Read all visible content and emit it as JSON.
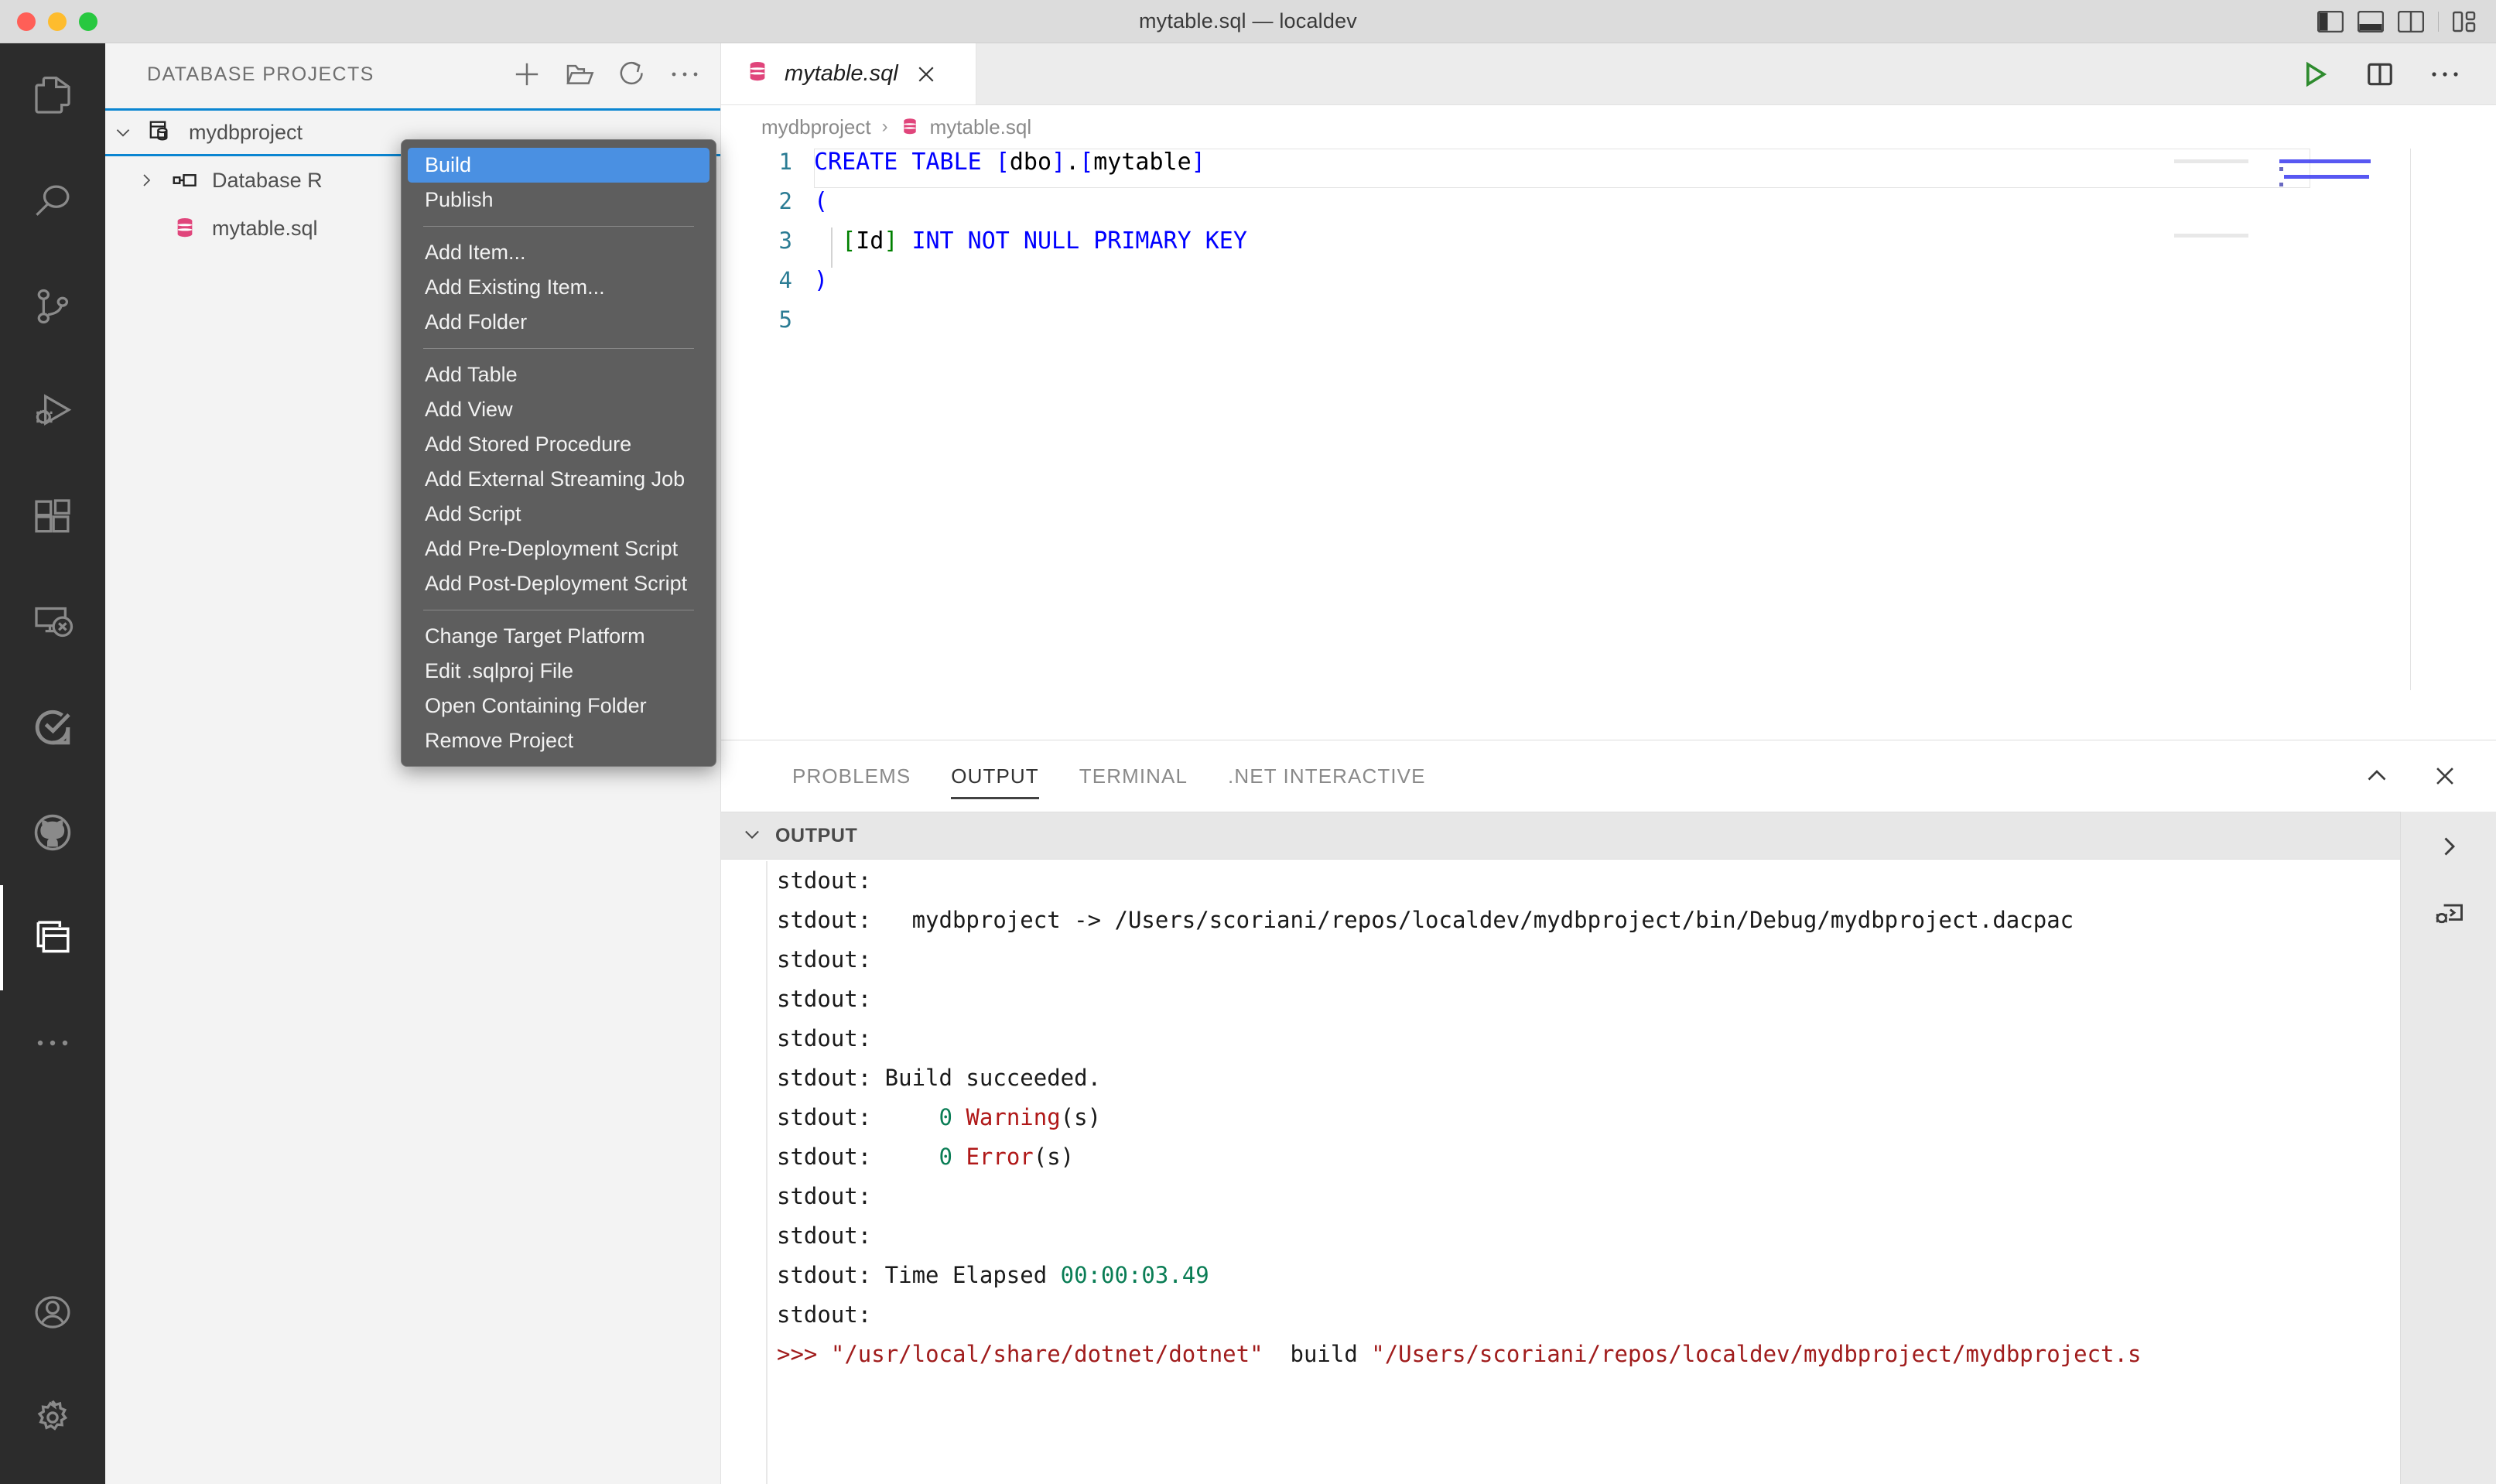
{
  "window": {
    "title": "mytable.sql — localdev",
    "traffic_lights": [
      "close",
      "minimize",
      "zoom"
    ],
    "layout_icons": [
      "toggle-primary-sidebar",
      "toggle-panel",
      "toggle-secondary-sidebar",
      "customize-layout"
    ]
  },
  "activitybar": {
    "items": [
      {
        "name": "explorer",
        "icon": "files-icon",
        "active": false
      },
      {
        "name": "search",
        "icon": "search-icon",
        "active": false
      },
      {
        "name": "source-control",
        "icon": "source-control-icon",
        "active": false
      },
      {
        "name": "run-and-debug",
        "icon": "run-debug-icon",
        "active": false
      },
      {
        "name": "extensions",
        "icon": "extensions-icon",
        "active": false
      },
      {
        "name": "remote-explorer",
        "icon": "remote-explorer-icon",
        "active": false
      },
      {
        "name": "azure",
        "icon": "azure-check-icon",
        "active": false
      },
      {
        "name": "github",
        "icon": "github-icon",
        "active": false
      },
      {
        "name": "database-projects",
        "icon": "database-projects-icon",
        "active": true
      },
      {
        "name": "additional-views",
        "icon": "ellipsis-icon",
        "active": false
      }
    ],
    "bottom": [
      {
        "name": "accounts",
        "icon": "account-icon"
      },
      {
        "name": "manage",
        "icon": "gear-icon"
      }
    ]
  },
  "sidebar": {
    "title": "DATABASE PROJECTS",
    "actions": [
      {
        "name": "new-project",
        "icon": "plus-icon"
      },
      {
        "name": "open-project",
        "icon": "folder-opened-icon"
      },
      {
        "name": "refresh",
        "icon": "refresh-icon"
      },
      {
        "name": "more-actions",
        "icon": "ellipsis-icon"
      }
    ],
    "tree": [
      {
        "label": "mydbproject",
        "icon": "database-project-icon",
        "expanded": true,
        "selected": true,
        "level": 0
      },
      {
        "label": "Database R",
        "icon": "references-icon",
        "expanded": false,
        "selected": false,
        "level": 1
      },
      {
        "label": "mytable.sql",
        "icon": "sql-file-icon",
        "expanded": null,
        "selected": false,
        "level": 2
      }
    ]
  },
  "context_menu": {
    "groups": [
      {
        "items": [
          {
            "label": "Build",
            "highlighted": true
          },
          {
            "label": "Publish",
            "highlighted": false
          }
        ]
      },
      {
        "items": [
          {
            "label": "Add Item...",
            "highlighted": false
          },
          {
            "label": "Add Existing Item...",
            "highlighted": false
          },
          {
            "label": "Add Folder",
            "highlighted": false
          }
        ]
      },
      {
        "items": [
          {
            "label": "Add Table",
            "highlighted": false
          },
          {
            "label": "Add View",
            "highlighted": false
          },
          {
            "label": "Add Stored Procedure",
            "highlighted": false
          },
          {
            "label": "Add External Streaming Job",
            "highlighted": false
          },
          {
            "label": "Add Script",
            "highlighted": false
          },
          {
            "label": "Add Pre-Deployment Script",
            "highlighted": false
          },
          {
            "label": "Add Post-Deployment Script",
            "highlighted": false
          }
        ]
      },
      {
        "items": [
          {
            "label": "Change Target Platform",
            "highlighted": false
          },
          {
            "label": "Edit .sqlproj File",
            "highlighted": false
          },
          {
            "label": "Open Containing Folder",
            "highlighted": false
          },
          {
            "label": "Remove Project",
            "highlighted": false
          }
        ]
      }
    ]
  },
  "editor": {
    "tab": {
      "label": "mytable.sql",
      "icon": "sql-file-icon",
      "preview_italic": true,
      "close_icon": "close-icon"
    },
    "tab_actions": [
      {
        "name": "run-query",
        "icon": "play-icon",
        "color": "#2e8b2e"
      },
      {
        "name": "split-editor",
        "icon": "split-editor-icon"
      },
      {
        "name": "more-editor-actions",
        "icon": "ellipsis-icon"
      }
    ],
    "breadcrumb": [
      {
        "label": "mydbproject",
        "icon": null
      },
      {
        "label": "mytable.sql",
        "icon": "sql-file-icon"
      }
    ],
    "lines": [
      {
        "number": "1",
        "text": "CREATE TABLE [dbo].[mytable]"
      },
      {
        "number": "2",
        "text": "("
      },
      {
        "number": "3",
        "text": "    [Id] INT NOT NULL PRIMARY KEY"
      },
      {
        "number": "4",
        "text": ")"
      },
      {
        "number": "5",
        "text": ""
      }
    ]
  },
  "panel": {
    "tabs": [
      {
        "label": "PROBLEMS",
        "active": false
      },
      {
        "label": "OUTPUT",
        "active": true
      },
      {
        "label": "TERMINAL",
        "active": false
      },
      {
        "label": ".NET INTERACTIVE",
        "active": false
      }
    ],
    "actions": [
      {
        "name": "maximize-panel",
        "icon": "chevron-up-icon"
      },
      {
        "name": "close-panel",
        "icon": "close-icon"
      }
    ],
    "section": {
      "label": "OUTPUT",
      "collapsed": false,
      "chevron": "chevron-down-icon"
    },
    "side_icons": [
      {
        "name": "expand-panel",
        "icon": "chevron-right-icon"
      },
      {
        "name": "debug-console",
        "icon": "debug-console-icon"
      }
    ],
    "output_lines": [
      "stdout:",
      "stdout:   mydbproject -> /Users/scoriani/repos/localdev/mydbproject/bin/Debug/mydbproject.dacpac",
      "stdout:",
      "stdout:",
      "stdout:",
      "stdout: Build succeeded.",
      "stdout:     0 Warning(s)",
      "stdout:     0 Error(s)",
      "stdout:",
      "stdout:",
      "stdout: Time Elapsed 00:00:03.49",
      "stdout:",
      ">>> \"/usr/local/share/dotnet/dotnet\"  build \"/Users/scoriani/repos/localdev/mydbproject/mydbproject.s"
    ]
  },
  "colors": {
    "accent_blue": "#0a85d1",
    "menu_highlight": "#4a90e2",
    "sql_icon_pink": "#e0457b",
    "keyword_blue": "#0000ff",
    "success_green": "#0a7d55",
    "error_red": "#b01818",
    "run_green": "#2e8b2e"
  }
}
